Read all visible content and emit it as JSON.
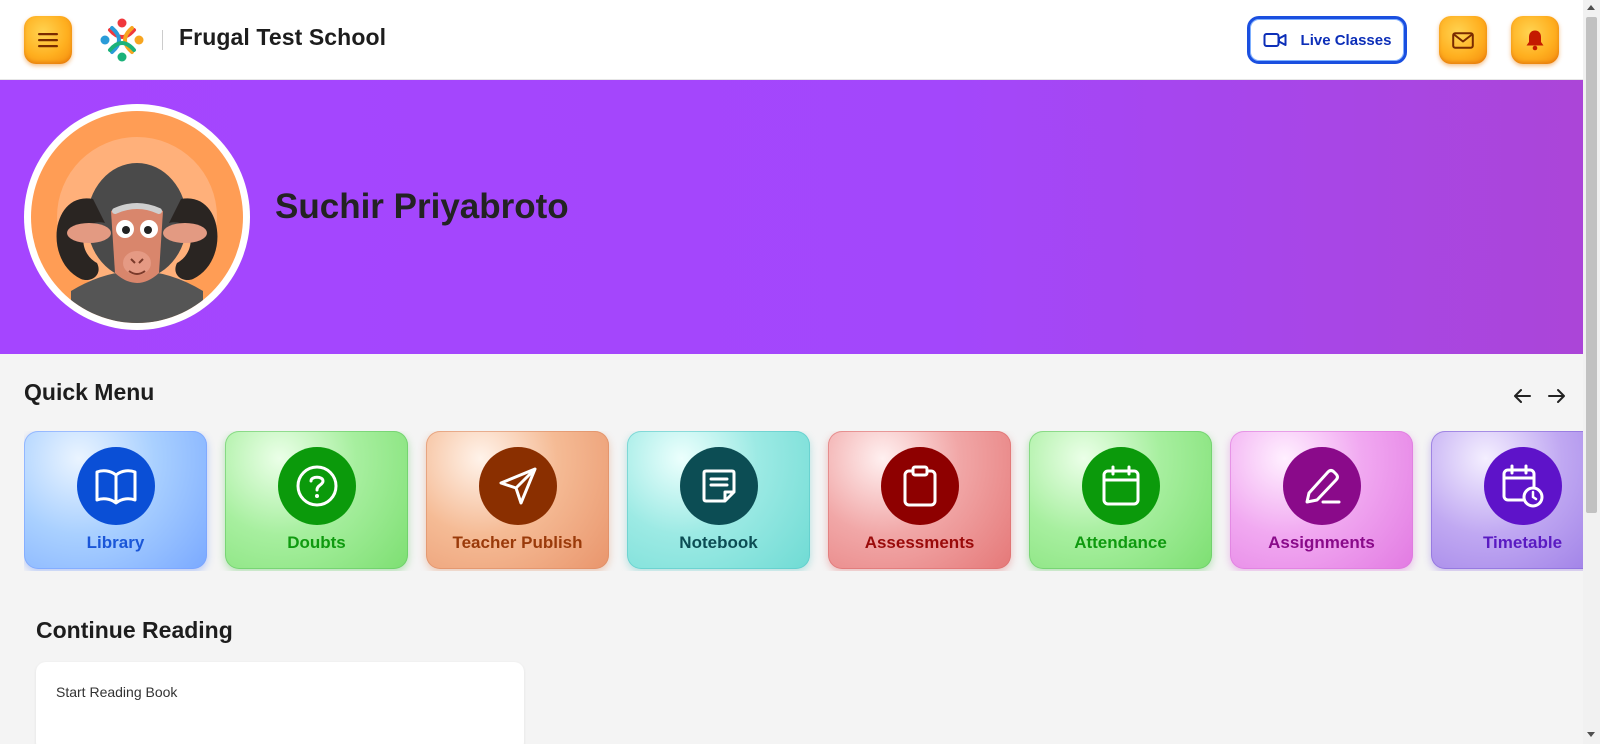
{
  "header": {
    "school_name": "Frugal Test School",
    "live_classes_label": "Live Classes",
    "menu_icon": "hamburger-icon",
    "mail_icon": "mail-icon",
    "bell_icon": "bell-icon"
  },
  "profile": {
    "name": "Suchir Priyabroto"
  },
  "quick_menu": {
    "title": "Quick Menu",
    "items": [
      {
        "label": "Library",
        "icon": "book-icon",
        "color": "#0a4fd6"
      },
      {
        "label": "Doubts",
        "icon": "question-icon",
        "color": "#0b9a0b"
      },
      {
        "label": "Teacher Publish",
        "icon": "send-icon",
        "color": "#8a2f00"
      },
      {
        "label": "Notebook",
        "icon": "note-icon",
        "color": "#0c4d54"
      },
      {
        "label": "Assessments",
        "icon": "clipboard-icon",
        "color": "#8e0000"
      },
      {
        "label": "Attendance",
        "icon": "calendar-icon",
        "color": "#0b9a0b"
      },
      {
        "label": "Assignments",
        "icon": "pen-icon",
        "color": "#8a0a8a"
      },
      {
        "label": "Timetable",
        "icon": "calendar-clock-icon",
        "color": "#5e13c9"
      }
    ]
  },
  "continue_reading": {
    "title": "Continue Reading",
    "card_text": "Start Reading Book"
  },
  "colors": {
    "banner": "#a545ff",
    "accent_orange": "#ffb020",
    "live_border": "#1a4fe0"
  }
}
